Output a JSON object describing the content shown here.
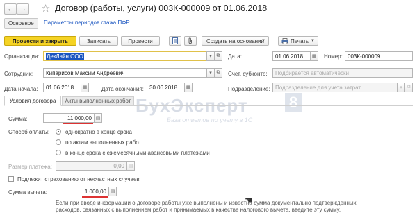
{
  "header": {
    "back": "←",
    "forward": "→",
    "star": "☆",
    "title": "Договор (работы, услуги) 003К-000009 от 01.06.2018"
  },
  "links": {
    "main": "Основное",
    "pfr": "Параметры периодов стажа ПФР"
  },
  "toolbar": {
    "post_close": "Провести и закрыть",
    "save": "Записать",
    "post": "Провести",
    "create_basis": "Создать на основании",
    "print": "Печать"
  },
  "form": {
    "org_label": "Организация:",
    "org_value": "ДекЛайн ООО",
    "date_label": "Дата:",
    "date_value": "01.06.2018",
    "number_label": "Номер:",
    "number_value": "003К-000009",
    "employee_label": "Сотрудник:",
    "employee_value": "Кипарисов Максим Андреевич",
    "account_label": "Счет, субконто:",
    "account_placeholder": "Подбирается автоматически",
    "start_label": "Дата начала:",
    "start_value": "01.06.2018",
    "end_label": "Дата окончания:",
    "end_value": "30.06.2018",
    "dept_label": "Подразделение:",
    "dept_placeholder": "Подразделение для учета затрат"
  },
  "tabs": {
    "terms": "Условия договора",
    "acts": "Акты выполненных работ"
  },
  "terms": {
    "sum_label": "Сумма:",
    "sum_value": "11 000,00",
    "payment_label": "Способ оплаты:",
    "opt1": "однократно в конце срока",
    "opt2": "по актам выполненных работ",
    "opt3": "в конце срока с ежемесячными авансовыми платежами",
    "payment_size_label": "Размер платежа:",
    "payment_size_value": "0,00",
    "insurance_label": "Подлежит страхованию от несчастных случаев",
    "deduction_label": "Сумма вычета:",
    "deduction_value": "1 000,00",
    "note": "Если при вводе информации о договоре работы уже выполнены и известна сумма документально подтвержденных расходов, связанных с выполнением работ и принимаемых в качестве налогового вычета, введите эту сумму."
  },
  "watermark": {
    "brand": "БухЭксперт",
    "digit": "8",
    "tagline": "База ответов по учету в 1С"
  },
  "colors": {
    "primary_button": "#f5d324",
    "highlight": "#1a55c0",
    "underline": "#d33"
  }
}
